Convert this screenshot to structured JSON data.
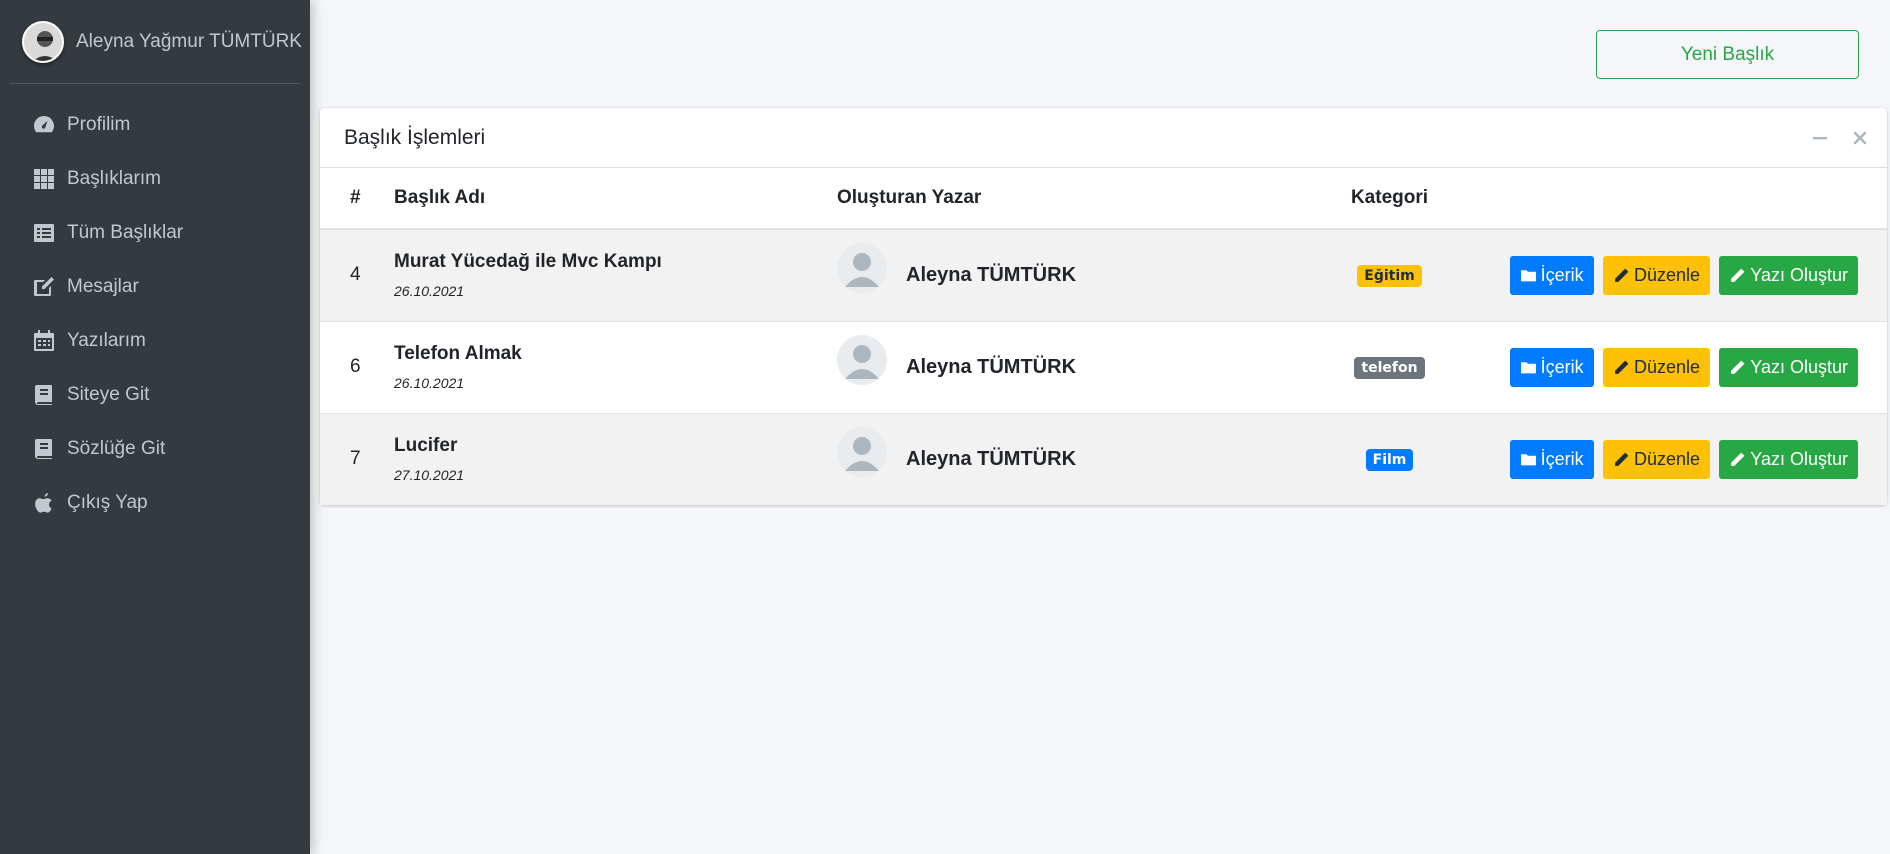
{
  "sidebar": {
    "user_name": "Aleyna Yağmur TÜMTÜRK",
    "items": [
      {
        "label": "Profilim",
        "icon": "tachometer-icon"
      },
      {
        "label": "Başlıklarım",
        "icon": "grid-icon"
      },
      {
        "label": "Tüm Başlıklar",
        "icon": "list-icon"
      },
      {
        "label": "Mesajlar",
        "icon": "edit-icon"
      },
      {
        "label": "Yazılarım",
        "icon": "calendar-icon"
      },
      {
        "label": "Siteye Git",
        "icon": "book-icon"
      },
      {
        "label": "Sözlüğe Git",
        "icon": "book-icon"
      },
      {
        "label": "Çıkış Yap",
        "icon": "apple-icon"
      }
    ]
  },
  "header": {
    "new_button_label": "Yeni Başlık"
  },
  "card": {
    "title": "Başlık İşlemleri",
    "columns": [
      "#",
      "Başlık Adı",
      "Oluşturan Yazar",
      "Kategori"
    ],
    "rows": [
      {
        "id": "4",
        "title": "Murat Yücedağ ile Mvc Kampı",
        "date": "26.10.2021",
        "author": "Aleyna TÜMTÜRK",
        "category": "Eğitim",
        "category_color": "#ffc107"
      },
      {
        "id": "6",
        "title": "Telefon Almak",
        "date": "26.10.2021",
        "author": "Aleyna TÜMTÜRK",
        "category": "telefon",
        "category_color": "#6c757d"
      },
      {
        "id": "7",
        "title": "Lucifer",
        "date": "27.10.2021",
        "author": "Aleyna TÜMTÜRK",
        "category": "Film",
        "category_color": "#007bff"
      }
    ],
    "actions": {
      "content_label": "İçerik",
      "edit_label": "Düzenle",
      "write_label": "Yazı Oluştur"
    }
  },
  "colors": {
    "sidebar_bg": "#343a40",
    "primary": "#007bff",
    "warning": "#ffc107",
    "success": "#28a745",
    "secondary": "#6c757d"
  }
}
